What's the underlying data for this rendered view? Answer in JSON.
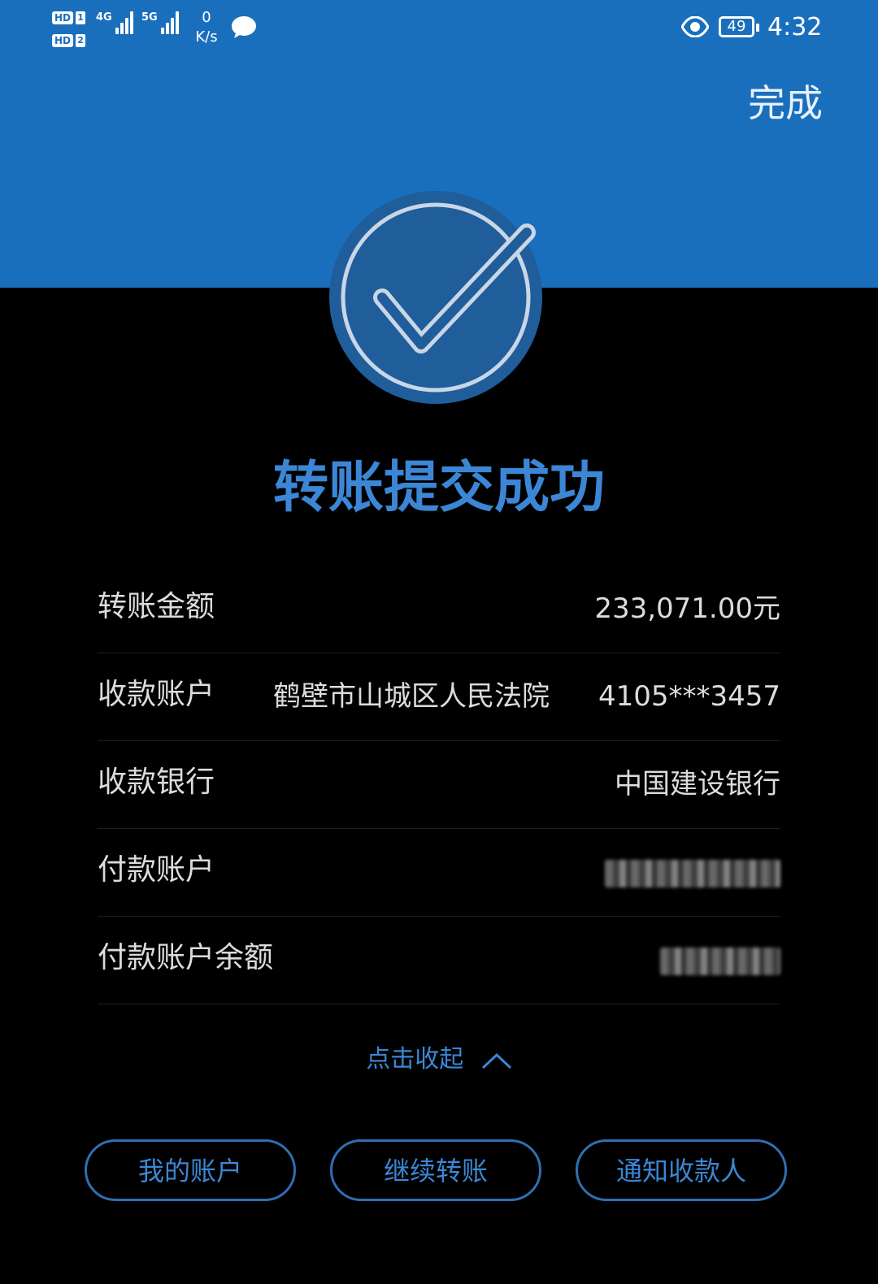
{
  "status_bar": {
    "sim1_badge": "HD",
    "sim1_num": "1",
    "sim2_badge": "HD",
    "sim2_num": "2",
    "net1": "4G",
    "net2": "5G",
    "speed_value": "0",
    "speed_unit": "K/s",
    "battery": "49",
    "time": "4:32",
    "icons": [
      "chat-bubble-icon",
      "eye-icon"
    ]
  },
  "header": {
    "done_label": "完成",
    "color": "#1a6fbd"
  },
  "success": {
    "icon": "check-circle-icon",
    "title": "转账提交成功",
    "accent": "#3b87d6"
  },
  "details": [
    {
      "label": "转账金额",
      "value": "233,071.00元"
    },
    {
      "label": "收款账户",
      "name": "鹤壁市山城区人民法院",
      "value": "4105***3457"
    },
    {
      "label": "收款银行",
      "value": "中国建设银行"
    },
    {
      "label": "付款账户"
    },
    {
      "label": "付款账户余额"
    }
  ],
  "collapse": {
    "label": "点击收起",
    "icon": "chevron-up-icon"
  },
  "actions": {
    "my_account": "我的账户",
    "continue_transfer": "继续转账",
    "notify_payee": "通知收款人"
  }
}
